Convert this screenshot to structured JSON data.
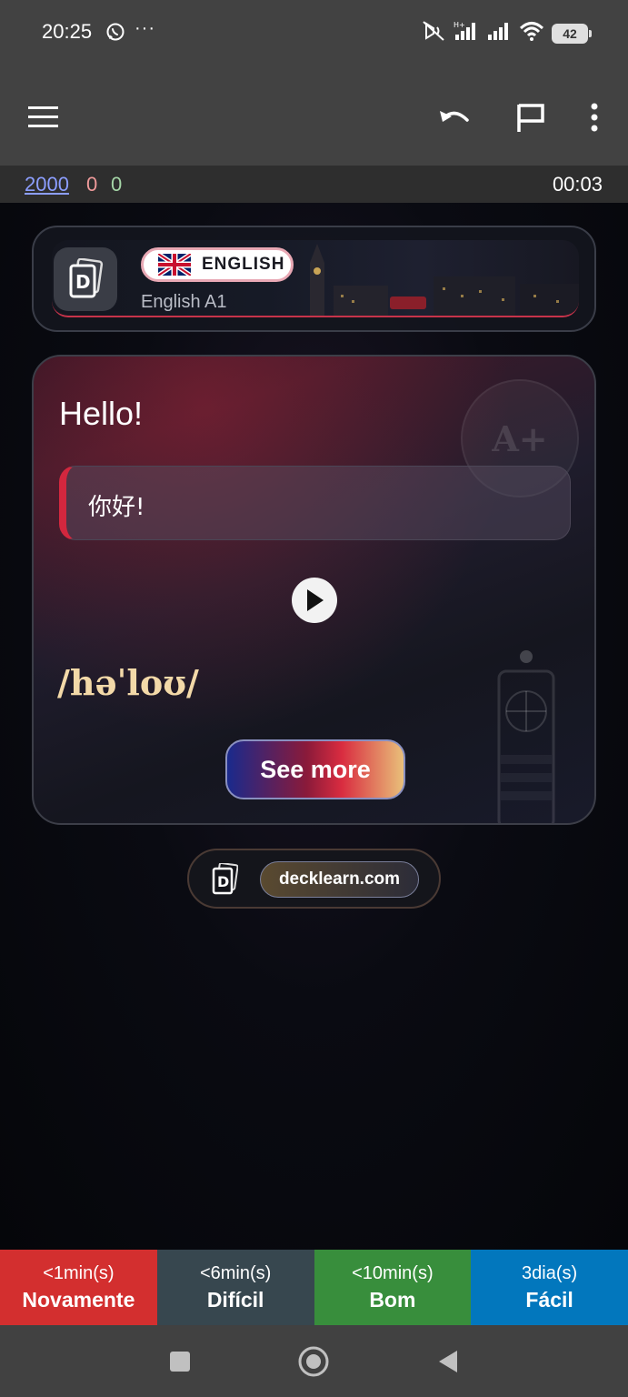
{
  "status_bar": {
    "time": "20:25",
    "dots": "···",
    "battery": "42",
    "icons": [
      "whatsapp-icon",
      "mute-icon",
      "signal-icon",
      "signal-icon",
      "wifi-icon",
      "battery-icon"
    ]
  },
  "toolbar": {
    "icons": [
      "menu-icon",
      "undo-icon",
      "flag-icon",
      "more-vert-icon"
    ]
  },
  "counts": {
    "new": "2000",
    "learning": "0",
    "review": "0",
    "timer": "00:03"
  },
  "header": {
    "language": "ENGLISH",
    "deck_name": "English A1"
  },
  "card": {
    "word": "Hello!",
    "translation": "你好!",
    "ipa": "/həˈloʊ/",
    "badge": "A+",
    "see_more": "See more"
  },
  "footer": {
    "site": "decklearn.com"
  },
  "answers": [
    {
      "time": "<1min(s)",
      "label": "Novamente",
      "color": "#d32f2f"
    },
    {
      "time": "<6min(s)",
      "label": "Difícil",
      "color": "#37474f"
    },
    {
      "time": "<10min(s)",
      "label": "Bom",
      "color": "#388e3c"
    },
    {
      "time": "3dia(s)",
      "label": "Fácil",
      "color": "#0277bd"
    }
  ],
  "nav": {
    "icons": [
      "recents-icon",
      "home-icon",
      "back-icon"
    ]
  }
}
